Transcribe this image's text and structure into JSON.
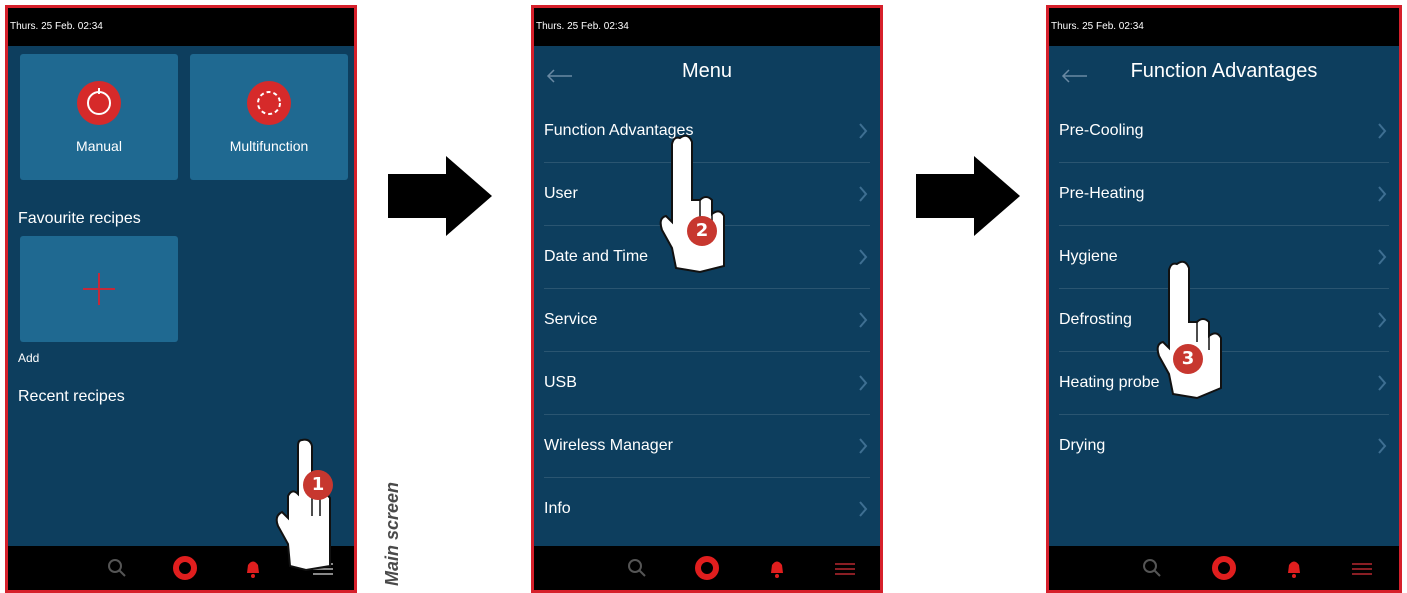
{
  "screens": [
    {
      "statusbar": "Thurs. 25 Feb. 02:34",
      "tiles": [
        "Manual",
        "Multifunction"
      ],
      "favourite_title": "Favourite recipes",
      "add_label": "Add",
      "recent_title": "Recent recipes",
      "step": "1"
    },
    {
      "statusbar": "Thurs. 25 Feb. 02:34",
      "title": "Menu",
      "items": [
        "Function Advantages",
        "User",
        "Date and Time",
        "Service",
        "USB",
        "Wireless Manager",
        "Info"
      ],
      "step": "2"
    },
    {
      "statusbar": "Thurs. 25 Feb. 02:34",
      "title": "Function Advantages",
      "items": [
        "Pre-Cooling",
        "Pre-Heating",
        "Hygiene",
        "Defrosting",
        "Heating probe",
        "Drying"
      ],
      "step": "3"
    }
  ],
  "caption": "Main screen",
  "colors": {
    "screen_bg": "#0d3e5e",
    "tile": "#1f6991",
    "accent_red": "#e01e1e",
    "frame": "#d6202b"
  },
  "icons": [
    "back-arrow-icon",
    "chevron-right-icon",
    "search-icon",
    "home-icon",
    "bell-icon",
    "menu-icon",
    "right-arrow-icon",
    "pointing-hand-icon"
  ]
}
